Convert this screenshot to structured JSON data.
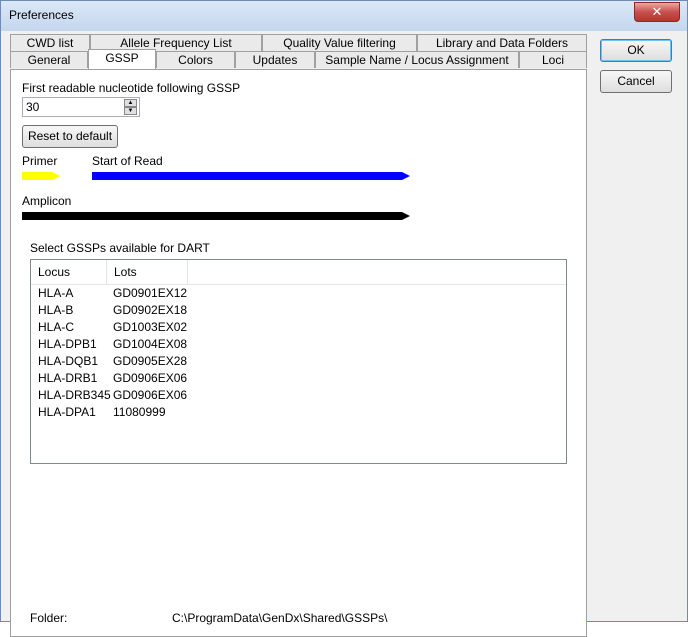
{
  "window": {
    "title": "Preferences",
    "close_glyph": "✕"
  },
  "tabs_top": [
    "CWD list",
    "Allele Frequency List",
    "Quality Value filtering",
    "Library and Data Folders"
  ],
  "tabs_bottom": [
    "General",
    "GSSP",
    "Colors",
    "Updates",
    "Sample Name / Locus Assignment",
    "Loci"
  ],
  "active_tab": "GSSP",
  "gssp": {
    "first_readable_label": "First readable nucleotide following GSSP",
    "first_readable_value": "30",
    "reset_label": "Reset to default",
    "primer_label": "Primer",
    "start_of_read_label": "Start of Read",
    "amplicon_label": "Amplicon",
    "select_label": "Select GSSPs available for DART",
    "columns": [
      "Locus",
      "Lots"
    ],
    "rows": [
      {
        "locus": "HLA-A",
        "lot": "GD0901EX12"
      },
      {
        "locus": "HLA-B",
        "lot": "GD0902EX18"
      },
      {
        "locus": "HLA-C",
        "lot": "GD1003EX02"
      },
      {
        "locus": "HLA-DPB1",
        "lot": "GD1004EX08"
      },
      {
        "locus": "HLA-DQB1",
        "lot": "GD0905EX28"
      },
      {
        "locus": "HLA-DRB1",
        "lot": "GD0906EX06"
      },
      {
        "locus": "HLA-DRB345",
        "lot": "GD0906EX06"
      },
      {
        "locus": "HLA-DPA1",
        "lot": "11080999"
      }
    ],
    "folder_label": "Folder:",
    "folder_path": "C:\\ProgramData\\GenDx\\Shared\\GSSPs\\"
  },
  "buttons": {
    "ok": "OK",
    "cancel": "Cancel"
  },
  "colors": {
    "primer": "#ffff00",
    "start_of_read": "#0000ff",
    "amplicon": "#000000"
  }
}
